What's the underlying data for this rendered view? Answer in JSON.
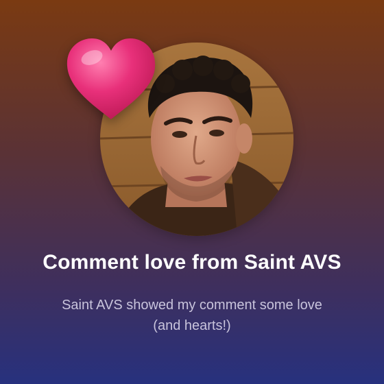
{
  "notification": {
    "title": "Comment love from Saint AVS",
    "body": "Saint AVS showed my comment some love (and hearts!)"
  },
  "icons": {
    "heart": "heart-icon",
    "avatar": "profile-avatar"
  },
  "colors": {
    "background_top": "#7a3a12",
    "background_bottom": "#27317e",
    "heart": "#e8307a",
    "title": "#ffffff",
    "subtitle": "#c9c4dc"
  }
}
